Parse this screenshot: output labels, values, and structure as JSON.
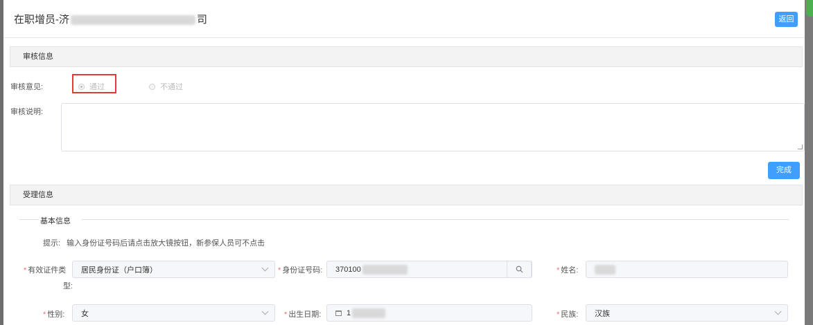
{
  "dialog": {
    "title_prefix": "在职增员-济",
    "title_suffix": "司",
    "return_label": "返回"
  },
  "review": {
    "section_title": "审核信息",
    "opinion_label": "审核意见:",
    "options": [
      "通过",
      "不通过"
    ],
    "selected": "通过",
    "note_label": "审核说明:",
    "note_value": "",
    "done_label": "完成"
  },
  "accept": {
    "section_title": "受理信息",
    "basic_title": "基本信息",
    "hint_label": "提示:",
    "hint_text": "输入身份证号码后请点击放大镜按钮，新参保人员可不点击"
  },
  "form": {
    "id_type_label_1": "有效证件类",
    "id_type_label_2": "型:",
    "id_type_value": "居民身份证（户口簿）",
    "id_no_label": "身份证号码:",
    "id_no_value": "370100",
    "name_label": "姓名:",
    "gender_label": "性别:",
    "gender_value": "女",
    "birth_label": "出生日期:",
    "birth_value": "1",
    "nation_label": "民族:",
    "nation_value": "汉族",
    "required_mark": "*"
  },
  "icons": [
    "search-icon",
    "calendar-icon",
    "chevron-down-icon",
    "radio-icon",
    "resize-grip-icon"
  ]
}
